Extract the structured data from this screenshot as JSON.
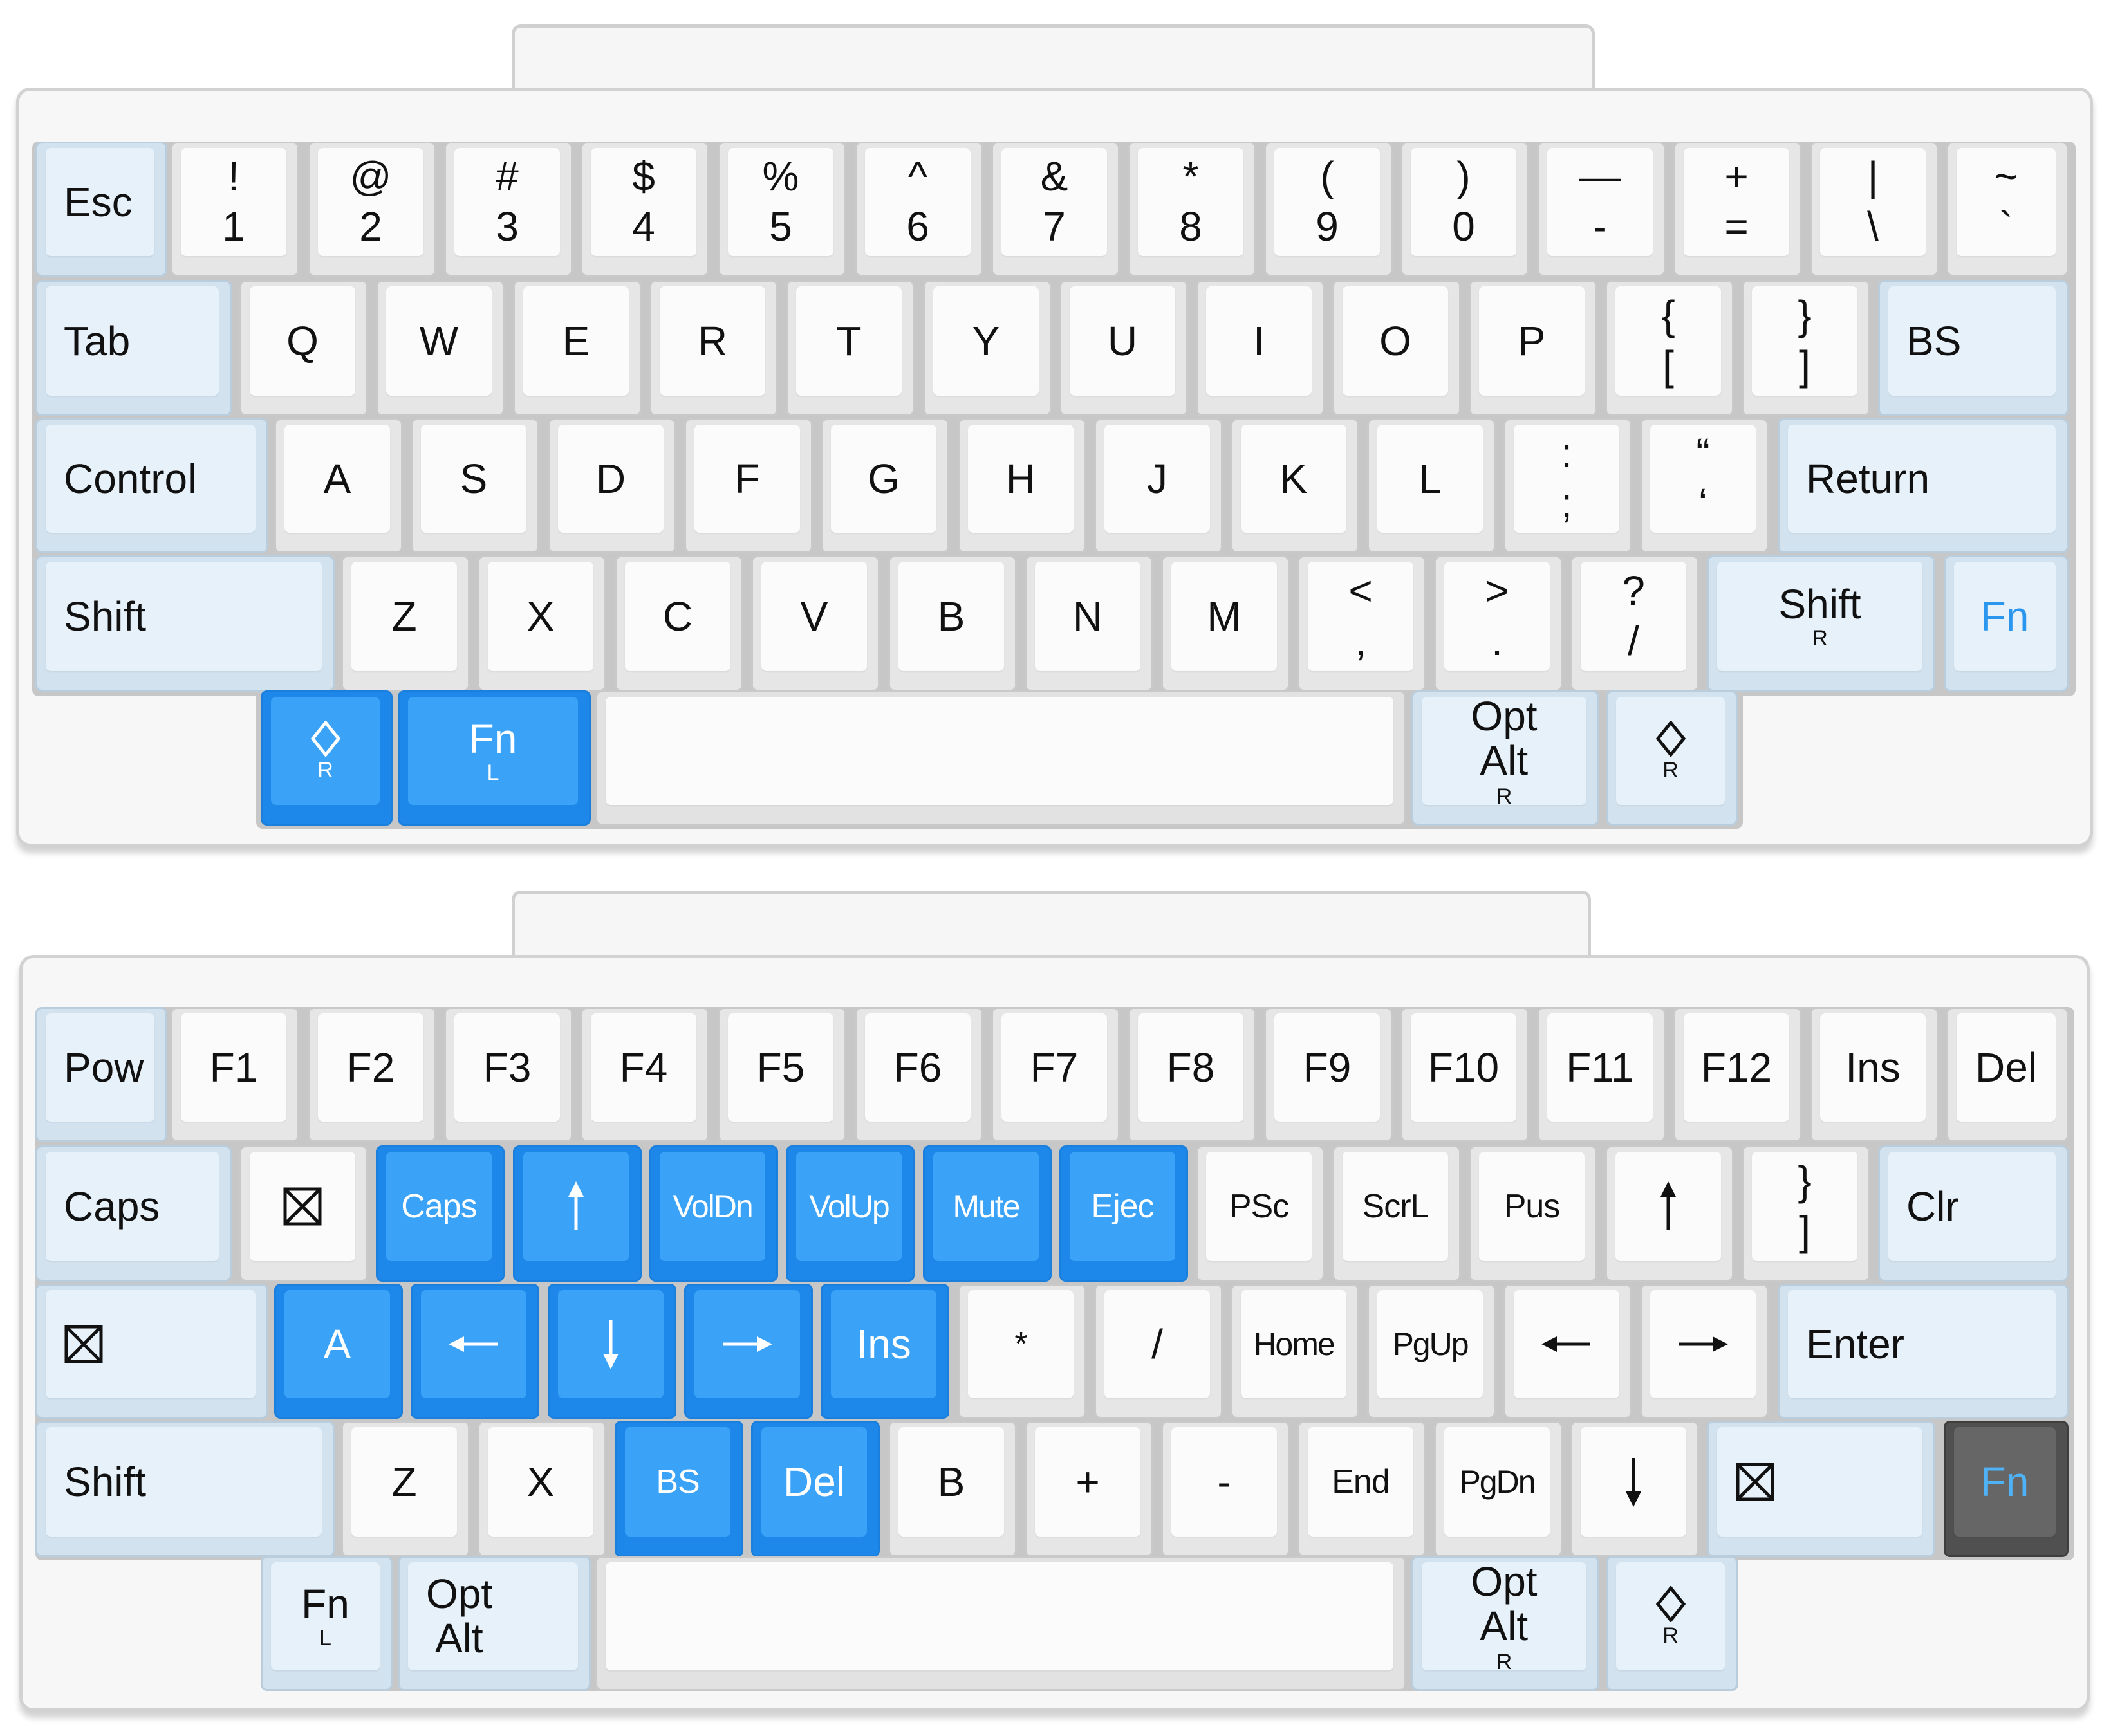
{
  "colors": {
    "case": "#f7f7f7",
    "keycap": "#fbfbfb",
    "modifier": "#e6f1fa",
    "highlight": "#3aa3f8",
    "active_fn": "#666666",
    "fn_text": "#2a96ee"
  },
  "keyboards": [
    {
      "layer": "base",
      "keys": [
        {
          "id": "esc",
          "type": "mod",
          "label": "Esc",
          "align": "left"
        },
        {
          "id": "1",
          "dual": [
            "!",
            "1"
          ]
        },
        {
          "id": "2",
          "dual": [
            "@",
            "2"
          ]
        },
        {
          "id": "3",
          "dual": [
            "#",
            "3"
          ]
        },
        {
          "id": "4",
          "dual": [
            "$",
            "4"
          ]
        },
        {
          "id": "5",
          "dual": [
            "%",
            "5"
          ]
        },
        {
          "id": "6",
          "dual": [
            "^",
            "6"
          ]
        },
        {
          "id": "7",
          "dual": [
            "&",
            "7"
          ]
        },
        {
          "id": "8",
          "dual": [
            "*",
            "8"
          ]
        },
        {
          "id": "9",
          "dual": [
            "(",
            "9"
          ]
        },
        {
          "id": "0",
          "dual": [
            ")",
            "0"
          ]
        },
        {
          "id": "minus",
          "dual": [
            "—",
            "-"
          ]
        },
        {
          "id": "equal",
          "dual": [
            "+",
            "="
          ]
        },
        {
          "id": "backslash",
          "dual": [
            "|",
            "\\"
          ]
        },
        {
          "id": "grave",
          "dual": [
            "~",
            "`"
          ]
        },
        {
          "id": "tab",
          "type": "mod",
          "label": "Tab",
          "align": "left"
        },
        {
          "id": "q",
          "label": "Q"
        },
        {
          "id": "w",
          "label": "W"
        },
        {
          "id": "e",
          "label": "E"
        },
        {
          "id": "r",
          "label": "R"
        },
        {
          "id": "t",
          "label": "T"
        },
        {
          "id": "y",
          "label": "Y"
        },
        {
          "id": "u",
          "label": "U"
        },
        {
          "id": "i",
          "label": "I"
        },
        {
          "id": "o",
          "label": "O"
        },
        {
          "id": "p",
          "label": "P"
        },
        {
          "id": "lbracket",
          "dual": [
            "{",
            "["
          ]
        },
        {
          "id": "rbracket",
          "dual": [
            "}",
            "]"
          ]
        },
        {
          "id": "bs",
          "type": "mod",
          "label": "BS",
          "align": "left"
        },
        {
          "id": "control",
          "type": "mod",
          "label": "Control",
          "align": "left"
        },
        {
          "id": "a",
          "label": "A"
        },
        {
          "id": "s",
          "label": "S"
        },
        {
          "id": "d",
          "label": "D"
        },
        {
          "id": "f",
          "label": "F"
        },
        {
          "id": "g",
          "label": "G"
        },
        {
          "id": "h",
          "label": "H"
        },
        {
          "id": "j",
          "label": "J"
        },
        {
          "id": "k",
          "label": "K"
        },
        {
          "id": "l",
          "label": "L"
        },
        {
          "id": "semicolon",
          "dual": [
            ":",
            ";"
          ]
        },
        {
          "id": "quote",
          "dual": [
            "“",
            "‘"
          ]
        },
        {
          "id": "return",
          "type": "mod",
          "label": "Return",
          "align": "left"
        },
        {
          "id": "lshift",
          "type": "mod",
          "label": "Shift",
          "align": "left"
        },
        {
          "id": "z",
          "label": "Z"
        },
        {
          "id": "x",
          "label": "X"
        },
        {
          "id": "c",
          "label": "C"
        },
        {
          "id": "v",
          "label": "V"
        },
        {
          "id": "b",
          "label": "B"
        },
        {
          "id": "n",
          "label": "N"
        },
        {
          "id": "m",
          "label": "M"
        },
        {
          "id": "comma",
          "dual": [
            "<",
            ","
          ]
        },
        {
          "id": "period",
          "dual": [
            ">",
            "."
          ]
        },
        {
          "id": "slash",
          "dual": [
            "?",
            "/"
          ]
        },
        {
          "id": "rshift",
          "type": "mod",
          "label": "Shift",
          "sub": "R"
        },
        {
          "id": "fn",
          "type": "mod",
          "label": "Fn",
          "style": "blue"
        },
        {
          "id": "lcmd",
          "type": "hi",
          "icon": "diamond",
          "sub": "R"
        },
        {
          "id": "lfn",
          "type": "hi",
          "label": "Fn",
          "sub": "L"
        },
        {
          "id": "space",
          "type": "space",
          "label": ""
        },
        {
          "id": "ropt",
          "type": "mod",
          "opt": [
            "Opt",
            "Alt"
          ],
          "sub": "R"
        },
        {
          "id": "rcmd",
          "type": "mod",
          "icon": "diamond",
          "sub": "R"
        }
      ]
    },
    {
      "layer": "fn",
      "keys": [
        {
          "id": "pow",
          "type": "mod",
          "label": "Pow",
          "align": "left"
        },
        {
          "id": "f1",
          "label": "F1"
        },
        {
          "id": "f2",
          "label": "F2"
        },
        {
          "id": "f3",
          "label": "F3"
        },
        {
          "id": "f4",
          "label": "F4"
        },
        {
          "id": "f5",
          "label": "F5"
        },
        {
          "id": "f6",
          "label": "F6"
        },
        {
          "id": "f7",
          "label": "F7"
        },
        {
          "id": "f8",
          "label": "F8"
        },
        {
          "id": "f9",
          "label": "F9"
        },
        {
          "id": "f10",
          "label": "F10"
        },
        {
          "id": "f11",
          "label": "F11"
        },
        {
          "id": "f12",
          "label": "F12"
        },
        {
          "id": "ins",
          "label": "Ins"
        },
        {
          "id": "del",
          "label": "Del"
        },
        {
          "id": "caps",
          "type": "mod",
          "label": "Caps",
          "align": "left"
        },
        {
          "id": "blank1",
          "icon": "boxx"
        },
        {
          "id": "capslock",
          "type": "hi",
          "label": "Caps",
          "style": "narrow"
        },
        {
          "id": "uparrow1",
          "type": "hi",
          "icon": "arrow-up"
        },
        {
          "id": "voldn",
          "type": "hi",
          "label": "VolDn",
          "style": "small"
        },
        {
          "id": "volup",
          "type": "hi",
          "label": "VolUp",
          "style": "small"
        },
        {
          "id": "mute",
          "type": "hi",
          "label": "Mute",
          "style": "small"
        },
        {
          "id": "ejec",
          "type": "hi",
          "label": "Ejec",
          "style": "narrow"
        },
        {
          "id": "psc",
          "label": "PSc",
          "style": "narrow"
        },
        {
          "id": "scrl",
          "label": "ScrL",
          "style": "narrow"
        },
        {
          "id": "pus",
          "label": "Pus",
          "style": "narrow"
        },
        {
          "id": "uparrow2",
          "icon": "arrow-up"
        },
        {
          "id": "rbrace2",
          "dual": [
            "}",
            "]"
          ]
        },
        {
          "id": "clr",
          "type": "mod",
          "label": "Clr",
          "align": "left"
        },
        {
          "id": "blank2",
          "type": "mod",
          "icon": "boxx",
          "align": "left"
        },
        {
          "id": "a2",
          "type": "hi",
          "label": "A"
        },
        {
          "id": "leftarrow1",
          "type": "hi",
          "icon": "arrow-left"
        },
        {
          "id": "downarrow1",
          "type": "hi",
          "icon": "arrow-down"
        },
        {
          "id": "rightarrow1",
          "type": "hi",
          "icon": "arrow-right"
        },
        {
          "id": "ins2",
          "type": "hi",
          "label": "Ins"
        },
        {
          "id": "asterisk",
          "label": "*",
          "style": "narrow"
        },
        {
          "id": "slash2",
          "label": "/"
        },
        {
          "id": "home",
          "label": "Home",
          "style": "small"
        },
        {
          "id": "pgup",
          "label": "PgUp",
          "style": "small"
        },
        {
          "id": "leftarrow2",
          "icon": "arrow-left"
        },
        {
          "id": "rightarrow2",
          "icon": "arrow-right"
        },
        {
          "id": "enter",
          "type": "mod",
          "label": "Enter",
          "align": "left"
        },
        {
          "id": "lshift2",
          "type": "mod",
          "label": "Shift",
          "align": "left"
        },
        {
          "id": "z2",
          "label": "Z"
        },
        {
          "id": "x2",
          "label": "X"
        },
        {
          "id": "bs2",
          "type": "hi",
          "label": "BS",
          "style": "narrow"
        },
        {
          "id": "del2",
          "type": "hi",
          "label": "Del"
        },
        {
          "id": "b2",
          "label": "B"
        },
        {
          "id": "plus",
          "label": "+"
        },
        {
          "id": "minus2",
          "label": "-"
        },
        {
          "id": "end",
          "label": "End",
          "style": "narrow"
        },
        {
          "id": "pgdn",
          "label": "PgDn",
          "style": "small"
        },
        {
          "id": "downarrow2",
          "icon": "arrow-down"
        },
        {
          "id": "blank3",
          "type": "mod",
          "icon": "boxx",
          "align": "left"
        },
        {
          "id": "fn2",
          "type": "dark",
          "label": "Fn"
        },
        {
          "id": "lfn2",
          "type": "mod",
          "label": "Fn",
          "sub": "L"
        },
        {
          "id": "lopt2",
          "type": "mod",
          "opt": [
            "Opt",
            "Alt"
          ],
          "align": "left"
        },
        {
          "id": "space2",
          "type": "space",
          "label": ""
        },
        {
          "id": "ropt2",
          "type": "mod",
          "opt": [
            "Opt",
            "Alt"
          ],
          "sub": "R"
        },
        {
          "id": "rcmd2",
          "type": "mod",
          "icon": "diamond",
          "sub": "R"
        }
      ]
    }
  ]
}
